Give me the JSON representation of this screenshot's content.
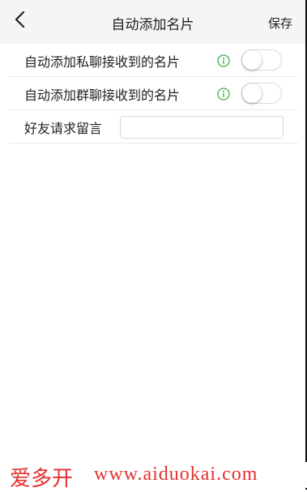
{
  "header": {
    "title": "自动添加名片",
    "save_label": "保存"
  },
  "settings": {
    "private_chat": {
      "label": "自动添加私聊接收到的名片",
      "enabled": false
    },
    "group_chat": {
      "label": "自动添加群聊接收到的名片",
      "enabled": false
    },
    "friend_request": {
      "label": "好友请求留言",
      "value": "",
      "placeholder": ""
    }
  },
  "watermark": {
    "chinese": "爱多开",
    "url": "www.aiduokai.com"
  },
  "colors": {
    "header_bg": "#f5f5f5",
    "info_icon": "#3cb043",
    "watermark": "#e53030",
    "divider": "#e8e8e8"
  },
  "icons": {
    "back": "chevron-left-icon",
    "info": "info-circle-icon"
  }
}
